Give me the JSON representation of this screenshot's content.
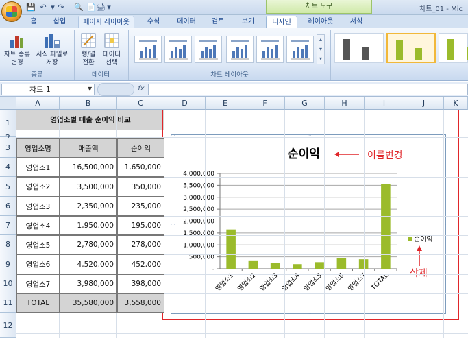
{
  "window": {
    "title": "차트_01 - Mic"
  },
  "chart_tools": {
    "label": "차트 도구"
  },
  "tabs": [
    {
      "label": "홈"
    },
    {
      "label": "삽입"
    },
    {
      "label": "페이지 레이아웃"
    },
    {
      "label": "수식"
    },
    {
      "label": "데이터"
    },
    {
      "label": "검토"
    },
    {
      "label": "보기"
    },
    {
      "label": "디자인"
    },
    {
      "label": "레이아웃"
    },
    {
      "label": "서식"
    }
  ],
  "ribbon": {
    "change_type": "차트 종류\n변경",
    "save_template": "서식 파일로\n저장",
    "group_type": "종류",
    "switch_row_col": "행/열\n전환",
    "select_data": "데이터\n선택",
    "group_data": "데이터",
    "group_layouts": "차트 레이아웃"
  },
  "formula_bar": {
    "name_box": "차트 1",
    "fx": "fx",
    "value": ""
  },
  "columns": [
    "A",
    "B",
    "C",
    "D",
    "E",
    "F",
    "G",
    "H",
    "I",
    "J",
    "K"
  ],
  "rows": [
    "1",
    "2",
    "3",
    "4",
    "5",
    "6",
    "7",
    "8",
    "9",
    "10",
    "11",
    "12"
  ],
  "sheet": {
    "title": "영업소별 매출 순이익 비교",
    "headers": [
      "영업소명",
      "매출액",
      "순이익"
    ],
    "data": [
      [
        "영업소1",
        "16,500,000",
        "1,650,000"
      ],
      [
        "영업소2",
        "3,500,000",
        "350,000"
      ],
      [
        "영업소3",
        "2,350,000",
        "235,000"
      ],
      [
        "영업소4",
        "1,950,000",
        "195,000"
      ],
      [
        "영업소5",
        "2,780,000",
        "278,000"
      ],
      [
        "영업소6",
        "4,520,000",
        "452,000"
      ],
      [
        "영업소7",
        "3,980,000",
        "398,000"
      ]
    ],
    "total": [
      "TOTAL",
      "35,580,000",
      "3,558,000"
    ]
  },
  "colors": {
    "bar": "#9bbb2b",
    "annotation": "#e0262a",
    "accent": "#15428b"
  },
  "annotations": {
    "rename": "이름변경",
    "delete": "삭제"
  },
  "chart_data": {
    "type": "bar",
    "title": "순이익",
    "categories": [
      "영업소1",
      "영업소2",
      "영업소3",
      "영업소4",
      "영업소5",
      "영업소6",
      "영업소7",
      "TOTAL"
    ],
    "series": [
      {
        "name": "순이익",
        "values": [
          1650000,
          350000,
          235000,
          195000,
          278000,
          452000,
          398000,
          3558000
        ]
      }
    ],
    "y_ticks": [
      "4,000,000",
      "3,500,000",
      "3,000,000",
      "2,500,000",
      "2,000,000",
      "1,500,000",
      "1,000,000",
      "500,000",
      "-"
    ],
    "ylim": [
      0,
      4000000
    ],
    "grid": true,
    "legend": "right"
  }
}
